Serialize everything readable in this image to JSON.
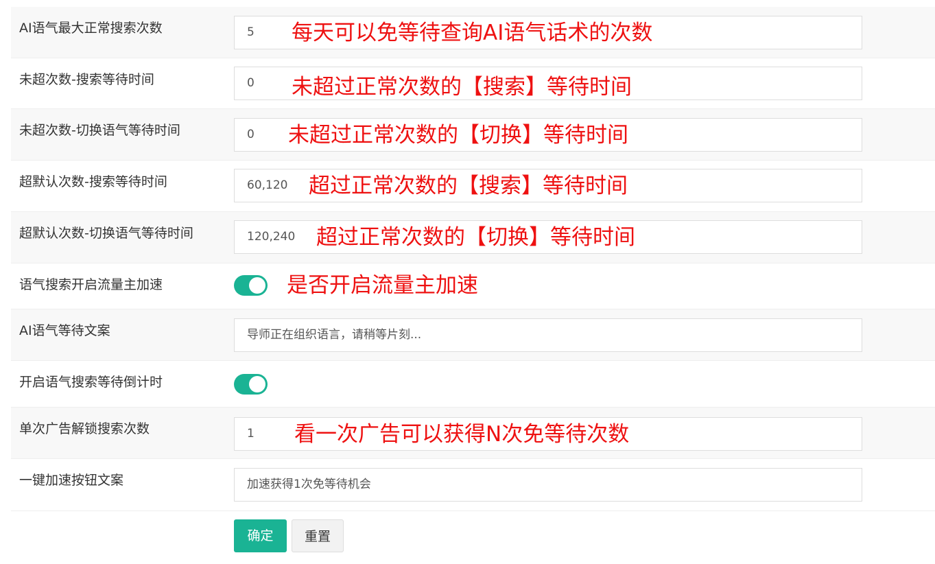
{
  "form": {
    "rows": [
      {
        "label": "AI语气最大正常搜索次数",
        "value": "5",
        "note": "每天可以免等待查询AI语气话术的次数"
      },
      {
        "label": "未超次数-搜索等待时间",
        "value": "0",
        "note": "未超过正常次数的【搜索】等待时间"
      },
      {
        "label": "未超次数-切换语气等待时间",
        "value": "0",
        "note": "未超过正常次数的【切换】等待时间"
      },
      {
        "label": "超默认次数-搜索等待时间",
        "value": "60,120",
        "note": "超过正常次数的【搜索】等待时间"
      },
      {
        "label": "超默认次数-切换语气等待时间",
        "value": "120,240",
        "note": "超过正常次数的【切换】等待时间"
      },
      {
        "label": "语气搜索开启流量主加速",
        "toggle": "on",
        "note": "是否开启流量主加速"
      },
      {
        "label": "AI语气等待文案",
        "value": "导师正在组织语言，请稍等片刻..."
      },
      {
        "label": "开启语气搜索等待倒计时",
        "toggle": "on"
      },
      {
        "label": "单次广告解锁搜索次数",
        "value": "1",
        "note": "看一次广告可以获得N次免等待次数"
      },
      {
        "label": "一键加速按钮文案",
        "value": "加速获得1次免等待机会"
      }
    ]
  },
  "buttons": {
    "confirm": "确定",
    "reset": "重置"
  },
  "colors": {
    "accent": "#1ab394",
    "annotation": "#ee1111",
    "row_alt": "#f8f8f8"
  }
}
